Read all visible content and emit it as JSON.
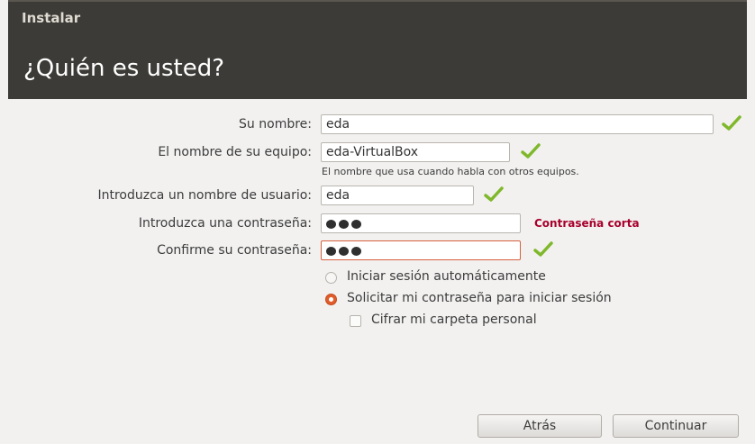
{
  "window": {
    "title": "Instalar"
  },
  "page": {
    "title": "¿Quién es usted?"
  },
  "form": {
    "name": {
      "label": "Su nombre:",
      "value": "eda"
    },
    "computer": {
      "label": "El nombre de su equipo:",
      "value": "eda-VirtualBox",
      "hint": "El nombre que usa cuando habla con otros equipos."
    },
    "username": {
      "label": "Introduzca un nombre de usuario:",
      "value": "eda"
    },
    "password": {
      "label": "Introduzca una contraseña:",
      "masked_length": 3,
      "error": "Contraseña corta"
    },
    "confirm": {
      "label": "Confirme su contraseña:",
      "masked_length": 3
    }
  },
  "options": {
    "auto_login": {
      "label": "Iniciar sesión automáticamente",
      "selected": false
    },
    "require_password": {
      "label": "Solicitar mi contraseña para iniciar sesión",
      "selected": true
    },
    "encrypt_home": {
      "label": "Cifrar mi carpeta personal",
      "checked": false
    }
  },
  "buttons": {
    "back": "Atrás",
    "continue": "Continuar"
  },
  "colors": {
    "header": "#3c3b37",
    "accent": "#e05c2a",
    "error": "#a8002b",
    "check": "#7fb82a"
  },
  "icons": {
    "valid": "checkmark-icon"
  }
}
